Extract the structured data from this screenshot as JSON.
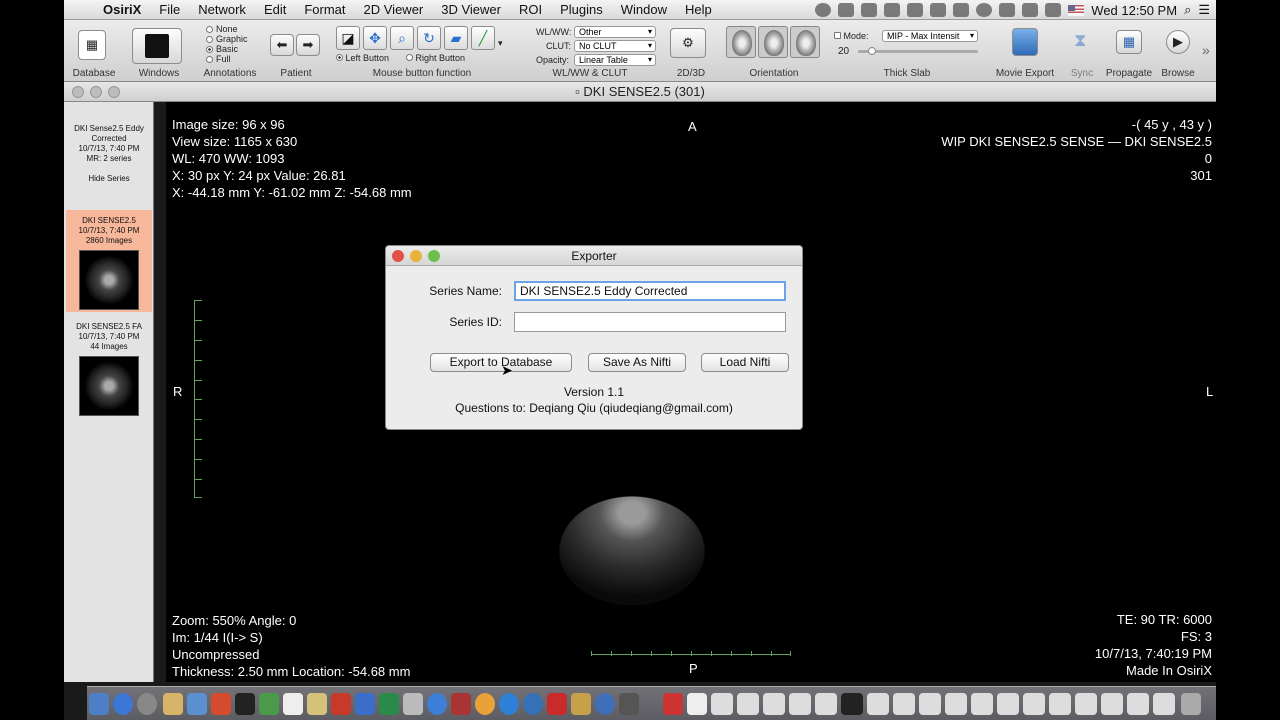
{
  "menubar": {
    "app": "OsiriX",
    "items": [
      "File",
      "Network",
      "Edit",
      "Format",
      "2D Viewer",
      "3D Viewer",
      "ROI",
      "Plugins",
      "Window",
      "Help"
    ],
    "clock": "Wed 12:50 PM"
  },
  "toolbar": {
    "captions": {
      "database": "Database",
      "windows": "Windows",
      "annotations": "Annotations",
      "patient": "Patient",
      "mouse": "Mouse button function",
      "wlww": "WL/WW & CLUT",
      "twod3d": "2D/3D",
      "orientation": "Orientation",
      "thickslab": "Thick Slab",
      "movie": "Movie Export",
      "sync": "Sync",
      "propagate": "Propagate",
      "browse": "Browse"
    },
    "annotations": [
      "None",
      "Graphic",
      "Basic",
      "Full"
    ],
    "annotation_selected": "Basic",
    "mouse_left": "Left Button",
    "mouse_right": "Right Button",
    "wlww_label": "WL/WW:",
    "wlww_value": "Other",
    "clut_label": "CLUT:",
    "clut_value": "No CLUT",
    "opacity_label": "Opacity:",
    "opacity_value": "Linear Table",
    "mode_label": "Mode:",
    "mode_value": "MIP - Max Intensit",
    "slab_value": "20"
  },
  "window": {
    "title": "DKI SENSE2.5 (301)"
  },
  "sidebar": {
    "study": {
      "line1": "DKI Sense2.5 Eddy",
      "line2": "Corrected",
      "line3": "10/7/13, 7:40 PM",
      "line4": "MR: 2 series",
      "hide": "Hide Series"
    },
    "series": [
      {
        "name": "DKI SENSE2.5",
        "date": "10/7/13, 7:40 PM",
        "count": "2860 Images"
      },
      {
        "name": "DKI SENSE2.5 FA",
        "date": "10/7/13, 7:40 PM",
        "count": "44 Images"
      }
    ]
  },
  "viewer": {
    "top_left": [
      "Image size: 96 x 96",
      "View size: 1165 x 630",
      "WL: 470 WW: 1093",
      "X: 30 px Y: 24 px Value: 26.81",
      "X: -44.18 mm Y: -61.02 mm Z: -54.68 mm"
    ],
    "top_right": [
      "-( 45 y , 43 y )",
      "WIP DKI SENSE2.5 SENSE — DKI SENSE2.5",
      "0",
      "301"
    ],
    "bottom_left": [
      "Zoom: 550% Angle: 0",
      "Im: 1/44  I(I-> S)",
      "Uncompressed",
      "Thickness: 2.50 mm Location: -54.68 mm"
    ],
    "bottom_right": [
      "TE:  90 TR:  6000",
      "FS:  3",
      "10/7/13, 7:40:19 PM",
      "Made In OsiriX"
    ],
    "orient_top": "A",
    "orient_bottom": "P",
    "orient_left": "R",
    "orient_right": "L"
  },
  "dialog": {
    "title": "Exporter",
    "series_name_label": "Series Name:",
    "series_name_value": "DKI SENSE2.5 Eddy Corrected",
    "series_id_label": "Series ID:",
    "series_id_value": "",
    "btn_export": "Export to Database",
    "btn_save": "Save As Nifti",
    "btn_load": "Load Nifti",
    "version": "Version 1.1",
    "contact": "Questions to: Deqiang Qiu (qiudeqiang@gmail.com)"
  }
}
